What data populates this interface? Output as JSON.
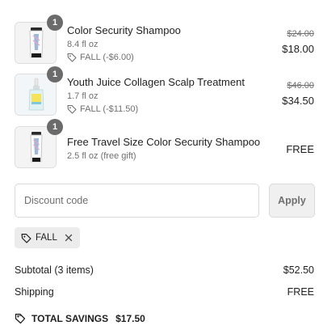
{
  "items": [
    {
      "quantity": "1",
      "name": "Color Security Shampoo",
      "variant": "8.4 fl oz",
      "discount": "FALL (-$6.00)",
      "original_price": "$24.00",
      "price": "$18.00",
      "image_icon": "shampoo-bottle-icon"
    },
    {
      "quantity": "1",
      "name": "Youth Juice Collagen Scalp Treatment",
      "variant": "1.7 fl oz",
      "discount": "FALL (-$11.50)",
      "original_price": "$46.00",
      "price": "$34.50",
      "image_icon": "dropper-bottle-icon"
    },
    {
      "quantity": "1",
      "name": "Free Travel Size Color Security Shampoo",
      "variant": "2.5 fl oz (free gift)",
      "price": "FREE",
      "image_icon": "shampoo-bottle-icon"
    }
  ],
  "discount_form": {
    "placeholder": "Discount code",
    "value": "",
    "apply_label": "Apply"
  },
  "applied_code": {
    "code": "FALL",
    "tag_icon": "tag-icon",
    "remove_icon": "close-icon"
  },
  "summary": {
    "subtotal_label": "Subtotal (3 items)",
    "subtotal_value": "$52.50",
    "shipping_label": "Shipping",
    "shipping_value": "FREE",
    "savings_label": "TOTAL SAVINGS",
    "savings_value": "$17.50",
    "savings_icon": "tag-icon"
  },
  "colors": {
    "text": "#1f1f1f",
    "muted": "#707070",
    "badge": "#6b6b6b",
    "border": "#d9d9d9",
    "chip_bg": "#ececec",
    "button_bg": "#f0f0f0"
  }
}
